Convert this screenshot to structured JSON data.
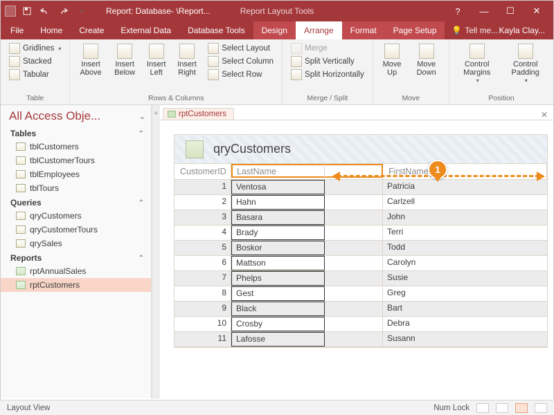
{
  "titlebar": {
    "title": "Report: Database- \\Report...",
    "context_title": "Report Layout Tools"
  },
  "window_controls": {
    "help": "?",
    "min": "—",
    "max": "☐",
    "close": "✕"
  },
  "menu": {
    "file": "File",
    "tabs": [
      "Home",
      "Create",
      "External Data",
      "Database Tools",
      "Design"
    ],
    "active": "Arrange",
    "more": [
      "Format",
      "Page Setup"
    ],
    "tell_me": "Tell me...",
    "user": "Kayla Clay..."
  },
  "ribbon": {
    "table": {
      "label": "Table",
      "items": [
        "Gridlines",
        "Stacked",
        "Tabular"
      ]
    },
    "rows_cols": {
      "label": "Rows & Columns",
      "insert": [
        "Insert Above",
        "Insert Below",
        "Insert Left",
        "Insert Right"
      ],
      "select": [
        "Select Layout",
        "Select Column",
        "Select Row"
      ]
    },
    "merge_split": {
      "label": "Merge / Split",
      "items": [
        "Merge",
        "Split Vertically",
        "Split Horizontally"
      ]
    },
    "move": {
      "label": "Move",
      "items": [
        "Move Up",
        "Move Down"
      ]
    },
    "position": {
      "label": "Position",
      "items": [
        "Control Margins",
        "Control Padding"
      ]
    }
  },
  "nav": {
    "header": "All Access Obje...",
    "sections": {
      "tables": {
        "label": "Tables",
        "items": [
          "tblCustomers",
          "tblCustomerTours",
          "tblEmployees",
          "tblTours"
        ]
      },
      "queries": {
        "label": "Queries",
        "items": [
          "qryCustomers",
          "qryCustomerTours",
          "qrySales"
        ]
      },
      "reports": {
        "label": "Reports",
        "items": [
          "rptAnnualSales",
          "rptCustomers"
        ],
        "selected": "rptCustomers"
      }
    }
  },
  "doc": {
    "tab": "rptCustomers",
    "report_title": "qryCustomers",
    "columns": {
      "id": "CustomerID",
      "last": "LastName",
      "first": "FirstName"
    },
    "rows": [
      {
        "id": "1",
        "last": "Ventosa",
        "first": "Patricia"
      },
      {
        "id": "2",
        "last": "Hahn",
        "first": "Carlzell"
      },
      {
        "id": "3",
        "last": "Basara",
        "first": "John"
      },
      {
        "id": "4",
        "last": "Brady",
        "first": "Terri"
      },
      {
        "id": "5",
        "last": "Boskor",
        "first": "Todd"
      },
      {
        "id": "6",
        "last": "Mattson",
        "first": "Carolyn"
      },
      {
        "id": "7",
        "last": "Phelps",
        "first": "Susie"
      },
      {
        "id": "8",
        "last": "Gest",
        "first": "Greg"
      },
      {
        "id": "9",
        "last": "Black",
        "first": "Bart"
      },
      {
        "id": "10",
        "last": "Crosby",
        "first": "Debra"
      },
      {
        "id": "11",
        "last": "Lafosse",
        "first": "Susann"
      }
    ]
  },
  "callout": {
    "num": "1"
  },
  "status": {
    "view": "Layout View",
    "numlock": "Num Lock"
  }
}
